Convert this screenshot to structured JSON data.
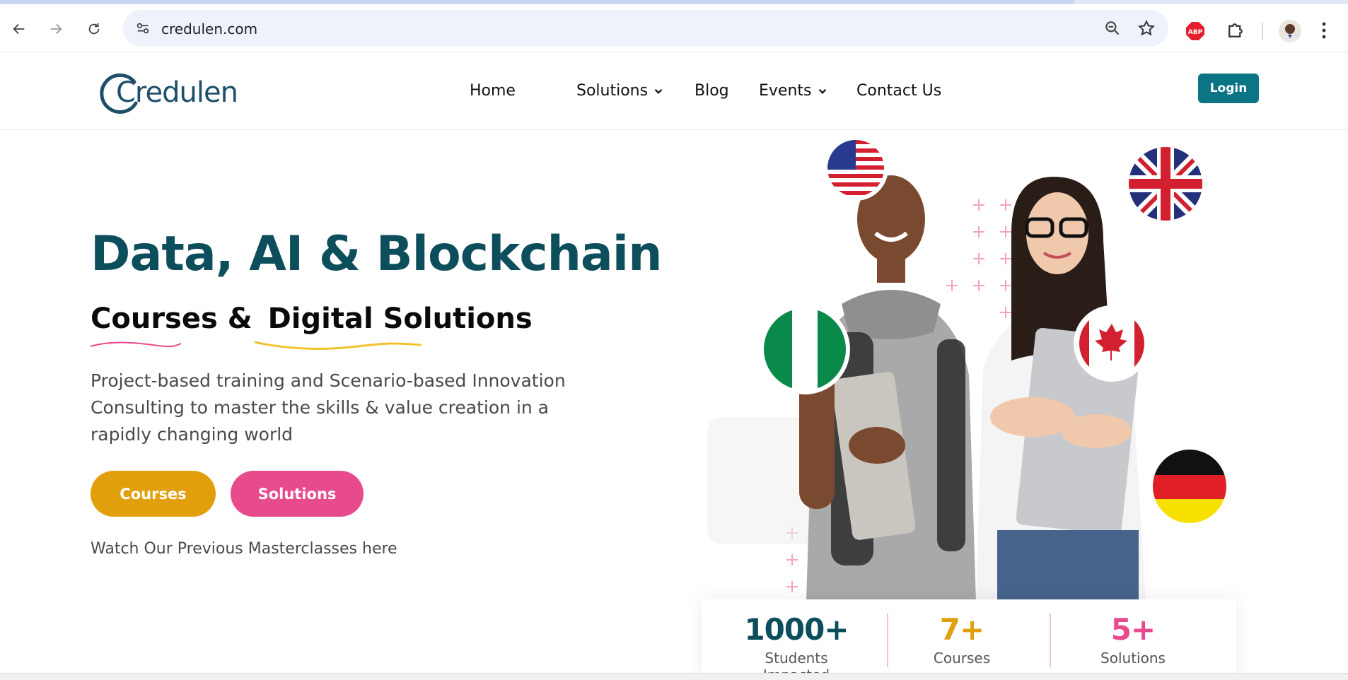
{
  "browser": {
    "url": "credulen.com",
    "icons": [
      "back-arrow-icon",
      "forward-arrow-icon",
      "reload-icon",
      "site-info-icon",
      "zoom-icon",
      "bookmark-star-icon",
      "adblock-plus-icon",
      "extensions-puzzle-icon",
      "profile-avatar",
      "menu-dots-icon"
    ],
    "abp_label": "ABP"
  },
  "header": {
    "logo_text": "Credulen",
    "nav": [
      {
        "label": "Home",
        "has_dropdown": false
      },
      {
        "label": "Solutions",
        "has_dropdown": true
      },
      {
        "label": "Blog",
        "has_dropdown": false
      },
      {
        "label": "Events",
        "has_dropdown": true
      },
      {
        "label": "Contact Us",
        "has_dropdown": false
      }
    ],
    "login_label": "Login"
  },
  "hero": {
    "title": "Data, AI & Blockchain",
    "subtitle_part1": "Courses &",
    "subtitle_part2": "Digital Solutions",
    "description": "Project-based training and Scenario-based Innovation Consulting to master the skills & value creation in a rapidly changing world",
    "courses_button": "Courses",
    "solutions_button": "Solutions",
    "masterclass_link": "Watch Our Previous Masterclasses here"
  },
  "stats": [
    {
      "value": "1000+",
      "label": "Students Impacted",
      "color": "#0c4e5c"
    },
    {
      "value": "7+",
      "label": "Courses",
      "color": "#e29f0c"
    },
    {
      "value": "5+",
      "label": "Solutions",
      "color": "#e84b8c"
    }
  ],
  "colors": {
    "brand_teal": "#0c4e5c",
    "login_teal": "#0c7585",
    "accent_orange": "#e29f0c",
    "accent_pink": "#e84b8c"
  }
}
